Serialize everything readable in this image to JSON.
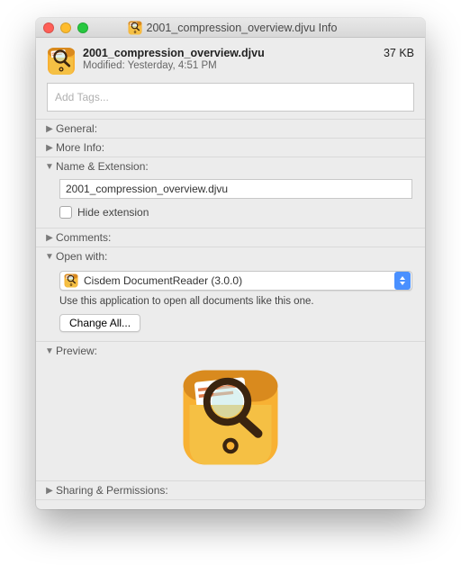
{
  "window": {
    "title": "2001_compression_overview.djvu Info"
  },
  "header": {
    "filename": "2001_compression_overview.djvu",
    "modified": "Modified: Yesterday, 4:51 PM",
    "filesize": "37 KB"
  },
  "tags": {
    "placeholder": "Add Tags..."
  },
  "sections": {
    "general": "General:",
    "more_info": "More Info:",
    "name_ext": "Name & Extension:",
    "comments": "Comments:",
    "open_with": "Open with:",
    "preview": "Preview:",
    "sharing": "Sharing & Permissions:"
  },
  "name_extension": {
    "value": "2001_compression_overview.djvu",
    "hide_label": "Hide extension"
  },
  "open_with": {
    "app_label": "Cisdem DocumentReader (3.0.0)",
    "help_text": "Use this application to open all documents like this one.",
    "change_all": "Change All..."
  },
  "icons": {
    "app_name": "cisdem-documentreader-icon"
  },
  "colors": {
    "accent_blue": "#4a90ff",
    "icon_orange": "#f5a623",
    "icon_dark": "#5a3a0f"
  }
}
